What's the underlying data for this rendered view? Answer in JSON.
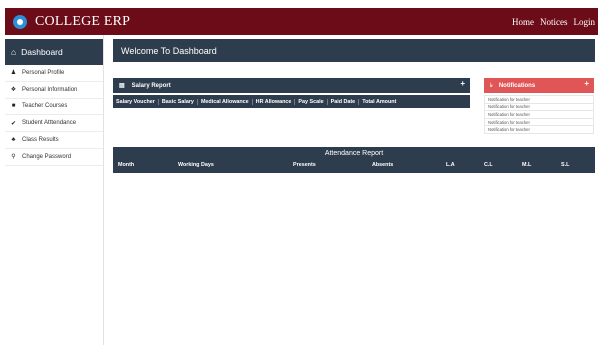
{
  "header": {
    "brand": "COLLEGE ERP",
    "nav": [
      "Home",
      "Notices",
      "Login"
    ]
  },
  "sidebar": {
    "title": "Dashboard",
    "items": [
      {
        "label": "Personal Profile",
        "icon": "user-icon"
      },
      {
        "label": "Personal Information",
        "icon": "info-icon"
      },
      {
        "label": "Teacher Courses",
        "icon": "book-icon"
      },
      {
        "label": "Student Atttendance",
        "icon": "check-circle-icon"
      },
      {
        "label": "Class Results",
        "icon": "users-icon"
      },
      {
        "label": "Change Password",
        "icon": "key-icon"
      }
    ]
  },
  "main": {
    "welcome": "Welcome To Dashboard",
    "salary": {
      "title": "Salary Report",
      "plus": "+",
      "columns": [
        "Salary Voucher",
        "Basic Salary",
        "Medical Allowance",
        "HR Allowance",
        "Pay Scale",
        "Paid Date",
        "Total Amount"
      ]
    },
    "notifications": {
      "title": "Notifications",
      "plus": "+",
      "items": [
        "Notification for teacher",
        "Notification for teacher",
        "Notification for teacher",
        "Notification for teacher",
        "Notification for teacher"
      ]
    },
    "attendance": {
      "title": "Attendance Report",
      "columns": [
        "Month",
        "Working Days",
        "Presents",
        "Absents",
        "L.A",
        "C.L",
        "M.L",
        "S.L"
      ]
    }
  },
  "colors": {
    "topbar": "#6b0c18",
    "panel": "#2e3d4d",
    "notification": "#e05656",
    "logo": "#2d8fd6"
  }
}
